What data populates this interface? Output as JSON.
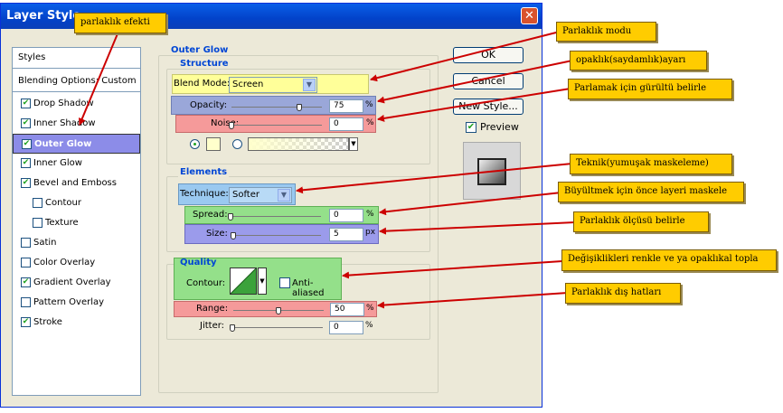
{
  "window": {
    "title": "Layer Style"
  },
  "styles_list": {
    "header": "Styles",
    "blending_options": "Blending Options: Custom",
    "items": [
      {
        "label": "Drop Shadow",
        "checked": true
      },
      {
        "label": "Inner Shadow",
        "checked": true
      },
      {
        "label": "Outer Glow",
        "checked": true,
        "selected": true
      },
      {
        "label": "Inner Glow",
        "checked": true
      },
      {
        "label": "Bevel and Emboss",
        "checked": true
      },
      {
        "label": "Contour",
        "checked": false
      },
      {
        "label": "Texture",
        "checked": false
      },
      {
        "label": "Satin",
        "checked": false
      },
      {
        "label": "Color Overlay",
        "checked": false
      },
      {
        "label": "Gradient Overlay",
        "checked": true
      },
      {
        "label": "Pattern Overlay",
        "checked": false
      },
      {
        "label": "Stroke",
        "checked": true
      }
    ]
  },
  "outer_glow": {
    "title": "Outer Glow",
    "structure": {
      "title": "Structure",
      "blend_mode_label": "Blend Mode:",
      "blend_mode_value": "Screen",
      "opacity_label": "Opacity:",
      "opacity_value": "75",
      "opacity_unit": "%",
      "opacity_level": 0.75,
      "noise_label": "Noise:",
      "noise_value": "0",
      "noise_unit": "%",
      "noise_level": 0.0
    },
    "elements": {
      "title": "Elements",
      "technique_label": "Technique:",
      "technique_value": "Softer",
      "spread_label": "Spread:",
      "spread_value": "0",
      "spread_unit": "%",
      "spread_level": 0.0,
      "size_label": "Size:",
      "size_value": "5",
      "size_unit": "px",
      "size_level": 0.03
    },
    "quality": {
      "title": "Quality",
      "contour_label": "Contour:",
      "anti_aliased_label": "Anti-aliased",
      "anti_aliased_checked": false,
      "range_label": "Range:",
      "range_value": "50",
      "range_unit": "%",
      "range_level": 0.5,
      "jitter_label": "Jitter:",
      "jitter_value": "0",
      "jitter_unit": "%",
      "jitter_level": 0.0
    }
  },
  "buttons": {
    "ok": "OK",
    "cancel": "Cancel",
    "new_style": "New Style...",
    "preview": "Preview",
    "preview_checked": true
  },
  "annotations": {
    "effect": "parlaklık efekti",
    "mode": "Parlaklık modu",
    "opacity": "opaklık(saydamlık)ayarı",
    "noise": "Parlamak için gürültü belirle",
    "technique": "Teknik(yumuşak maskeleme)",
    "spread": "Büyültmek için önce layeri maskele",
    "size": "Parlaklık ölçüsü belirle",
    "contour": "Değişiklikleri renkle ve ya opaklıkal topla",
    "range": "Parlaklık dış hatları"
  },
  "colors": {
    "highlight_yellow": "#ffff99",
    "highlight_blue": "#9aa7d9",
    "highlight_red": "#f59a9a",
    "highlight_green": "#94e08a",
    "highlight_purple": "#9b9beb",
    "callout": "#ffcc00",
    "arrow": "#cc0000",
    "selected_item": "#8c8ce8"
  }
}
